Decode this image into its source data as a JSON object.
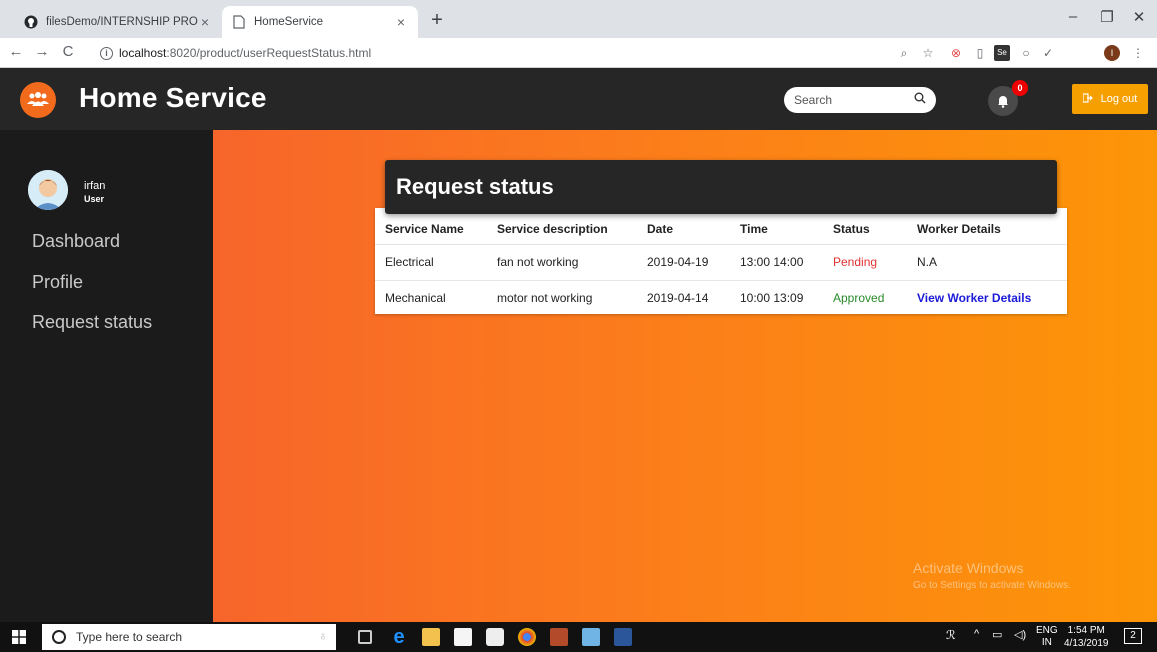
{
  "browser": {
    "tabs": [
      {
        "title": "filesDemo/INTERNSHIP PROJECT",
        "active": false
      },
      {
        "title": "HomeService",
        "active": true
      }
    ],
    "url_host": "localhost",
    "url_path": ":8020/product/userRequestStatus.html"
  },
  "header": {
    "brand": "Home Service",
    "search_placeholder": "Search",
    "notification_count": "0",
    "logout_label": "Log out"
  },
  "sidebar": {
    "user_name": "irfan",
    "user_role": "User",
    "items": [
      {
        "label": "Dashboard"
      },
      {
        "label": "Profile"
      },
      {
        "label": "Request status"
      }
    ]
  },
  "main": {
    "title": "Request status",
    "columns": [
      "Service Name",
      "Service description",
      "Date",
      "Time",
      "Status",
      "Worker Details"
    ],
    "rows": [
      {
        "service": "Electrical",
        "description": "fan not working",
        "date": "2019-04-19",
        "time": "13:00 14:00",
        "status": "Pending",
        "worker": "N.A"
      },
      {
        "service": "Mechanical",
        "description": "motor not working",
        "date": "2019-04-14",
        "time": "10:00 13:09",
        "status": "Approved",
        "worker": "View Worker Details"
      }
    ],
    "watermark_line1": "Activate Windows",
    "watermark_line2": "Go to Settings to activate Windows."
  },
  "taskbar": {
    "search_placeholder": "Type here to search",
    "lang": "ENG",
    "region": "IN",
    "time": "1:54 PM",
    "date": "4/13/2019",
    "notifications": "2"
  },
  "colors": {
    "header_bg": "#262626",
    "sidebar_bg": "#1b1b1b",
    "accent_orange": "#f26b1d",
    "logout_bg": "#f5a000",
    "pending": "#e03131",
    "approved": "#2a8a2a",
    "link": "#1a1ad8"
  }
}
